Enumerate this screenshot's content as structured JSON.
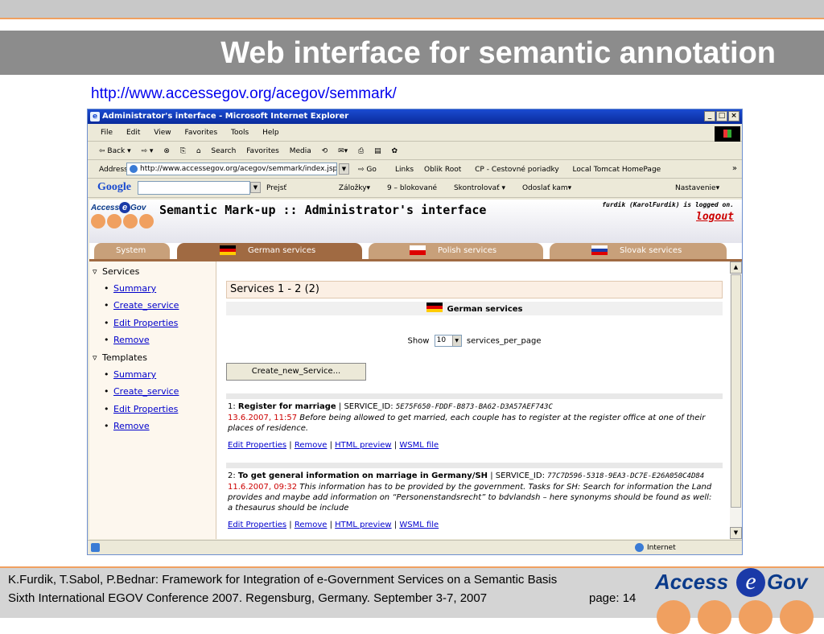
{
  "slide": {
    "title": "Web interface for semantic annotation",
    "url": "http://www.accessegov.org/acegov/semmark/",
    "footer_line1": "K.Furdik, T.Sabol, P.Bednar: Framework for Integration of e-Government Services on a Semantic Basis",
    "footer_line2": "Sixth International EGOV Conference 2007. Regensburg, Germany. September 3-7, 2007",
    "footer_page": "page: 14",
    "logo_left": "Access",
    "logo_e": "e",
    "logo_right": "Gov"
  },
  "browser": {
    "title": "Administrator's interface - Microsoft Internet Explorer",
    "win_buttons": [
      "_",
      "□",
      "×"
    ],
    "menu": [
      "File",
      "Edit",
      "View",
      "Favorites",
      "Tools",
      "Help"
    ],
    "toolbar": [
      "⇦ Back ▾",
      "⇨ ▾",
      "⊗",
      "⎘",
      "⌂",
      "Search",
      "Favorites",
      "Media",
      "⟲",
      "✉▾",
      "⎙",
      "▤",
      "✿"
    ],
    "address_label": "Address",
    "address": "http://www.accessegov.org/acegov/semmark/index.jsp",
    "go_label": "Go",
    "links": [
      "Links",
      "Oblik Root",
      "CP - Cestovné poriadky",
      "Local Tomcat HomePage",
      "»"
    ],
    "google_logo": "Google",
    "google_toolbar": [
      "Prejsť",
      "Záložky▾",
      "9 – blokované",
      "Skontrolovať ▾",
      "Odoslať kam▾",
      "Nastavenie▾"
    ],
    "status_zone": "Internet"
  },
  "app": {
    "logo_left": "Access",
    "logo_e": "e",
    "logo_right": "Gov",
    "title": "Semantic Mark-up :: Administrator's interface",
    "logged_on": "furdik (KarolFurdik) is logged on.",
    "logout": "logout",
    "tabs": [
      {
        "label": "System",
        "flag": ""
      },
      {
        "label": "German services",
        "flag": "de"
      },
      {
        "label": "Polish services",
        "flag": "pl"
      },
      {
        "label": "Slovak services",
        "flag": "sk"
      }
    ],
    "selected_tab": "German services",
    "sidebar": {
      "services_header": "Services",
      "services_items": [
        "Summary",
        "Create_service",
        "Edit Properties",
        "Remove"
      ],
      "templates_header": "Templates",
      "templates_items": [
        "Summary",
        "Create_service",
        "Edit Properties",
        "Remove"
      ]
    },
    "main": {
      "services_count": "Services 1 - 2 (2)",
      "section_title": "German services",
      "show_label": "Show",
      "per_page_value": "10",
      "per_page_suffix": "services_per_page",
      "create_button": "Create_new_Service...",
      "services": [
        {
          "num": "1:",
          "name": "Register for marriage",
          "id_label": "| SERVICE_ID:",
          "id_value": "5E75F650-FDDF-B873-BA62-D3A57AEF743C",
          "id_value_cont": "",
          "date": "13.6.2007, 11:57",
          "description": "Before being allowed to get married, each couple has to register at the register office at one of their places of residence.",
          "actions": [
            "Edit Properties",
            "Remove",
            "HTML preview",
            "WSML file"
          ]
        },
        {
          "num": "2:",
          "name": "To get general information on marriage in Germany/SH",
          "id_label": "| SERVICE_ID:",
          "id_value": "77C7D596-5318-9EA3-",
          "id_value_cont": "DC7E-E26A050C4D84",
          "date": "11.6.2007, 09:32",
          "description": "This information has to be provided by the government. Tasks for SH: Search for information the Land provides and maybe add information on “Personenstandsrecht” to bdvlandsh – here synonyms should be found as well: a thesaurus should be include",
          "actions": [
            "Edit Properties",
            "Remove",
            "HTML preview",
            "WSML file"
          ]
        }
      ]
    }
  }
}
